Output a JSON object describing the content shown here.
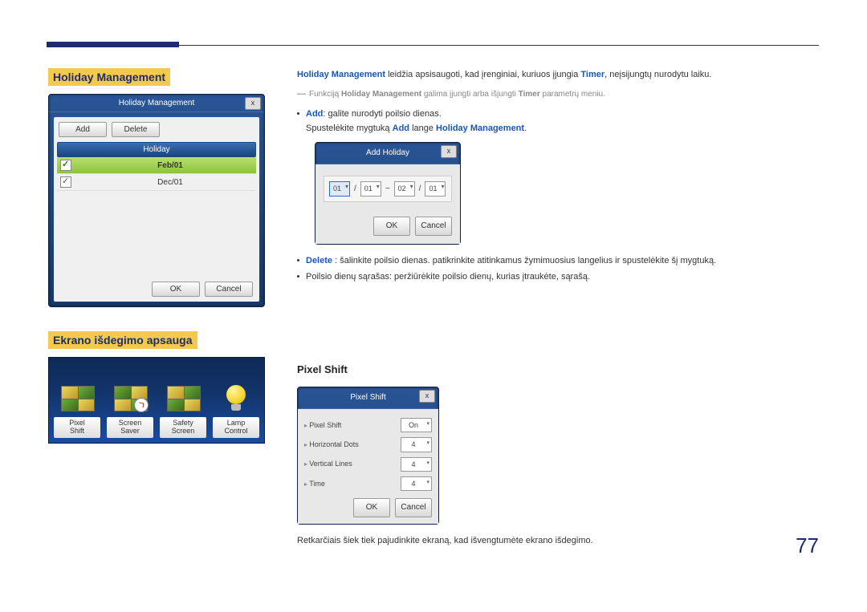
{
  "page_number": "77",
  "sections": {
    "holiday_mgmt": {
      "label": "Holiday Management",
      "dialog": {
        "title": "Holiday Management",
        "add_btn": "Add",
        "delete_btn": "Delete",
        "col_header": "Holiday",
        "rows": [
          "Feb/01",
          "Dec/01"
        ],
        "ok": "OK",
        "cancel": "Cancel"
      }
    },
    "screen_burn": {
      "label": "Ekrano išdegimo apsauga",
      "tiles": {
        "pixel_shift": "Pixel\nShift",
        "screen_saver": "Screen\nSaver",
        "safety_screen": "Safety\nScreen",
        "lamp_control": "Lamp\nControl"
      }
    }
  },
  "right": {
    "intro": {
      "hl1": "Holiday Management",
      "t1": " leidžia apsisaugoti, kad įrenginiai, kuriuos įjungia ",
      "hl2": "Timer",
      "t2": ", neįsijungtų nurodytu laiku."
    },
    "note": {
      "p1": "Funkciją ",
      "hl1": "Holiday Management",
      "p2": " galima įjungti arba išjungti ",
      "hl2": "Timer",
      "p3": " parametrų meniu."
    },
    "add_line": {
      "hl": "Add",
      "t": ": galite nurodyti poilsio dienas."
    },
    "add_line2": {
      "p1": "Spustelėkite mygtuką ",
      "hl1": "Add",
      "p2": " lange ",
      "hl2": "Holiday Management",
      "p3": "."
    },
    "add_dialog": {
      "title": "Add Holiday",
      "m1": "01",
      "d1": "01",
      "tilde": "~",
      "m2": "02",
      "d2": "01",
      "ok": "OK",
      "cancel": "Cancel"
    },
    "delete_line": {
      "hl": "Delete",
      "t": " : šalinkite poilsio dienas. patikrinkite atitinkamus žymimuosius langelius ir spustelėkite šį mygtuką."
    },
    "list_line": "Poilsio dienų sąrašas: peržiūrėkite poilsio dienų, kurias įtraukėte, sąrašą.",
    "pixel_shift": {
      "heading": "Pixel Shift",
      "title": "Pixel Shift",
      "rows": {
        "r1_lab": "Pixel Shift",
        "r1_val": "On",
        "r2_lab": "Horizontal Dots",
        "r2_val": "4",
        "r3_lab": "Vertical Lines",
        "r3_val": "4",
        "r4_lab": "Time",
        "r4_val": "4"
      },
      "ok": "OK",
      "cancel": "Cancel",
      "desc": "Retkarčiais šiek tiek pajudinkite ekraną, kad išvengtumėte ekrano išdegimo."
    }
  }
}
